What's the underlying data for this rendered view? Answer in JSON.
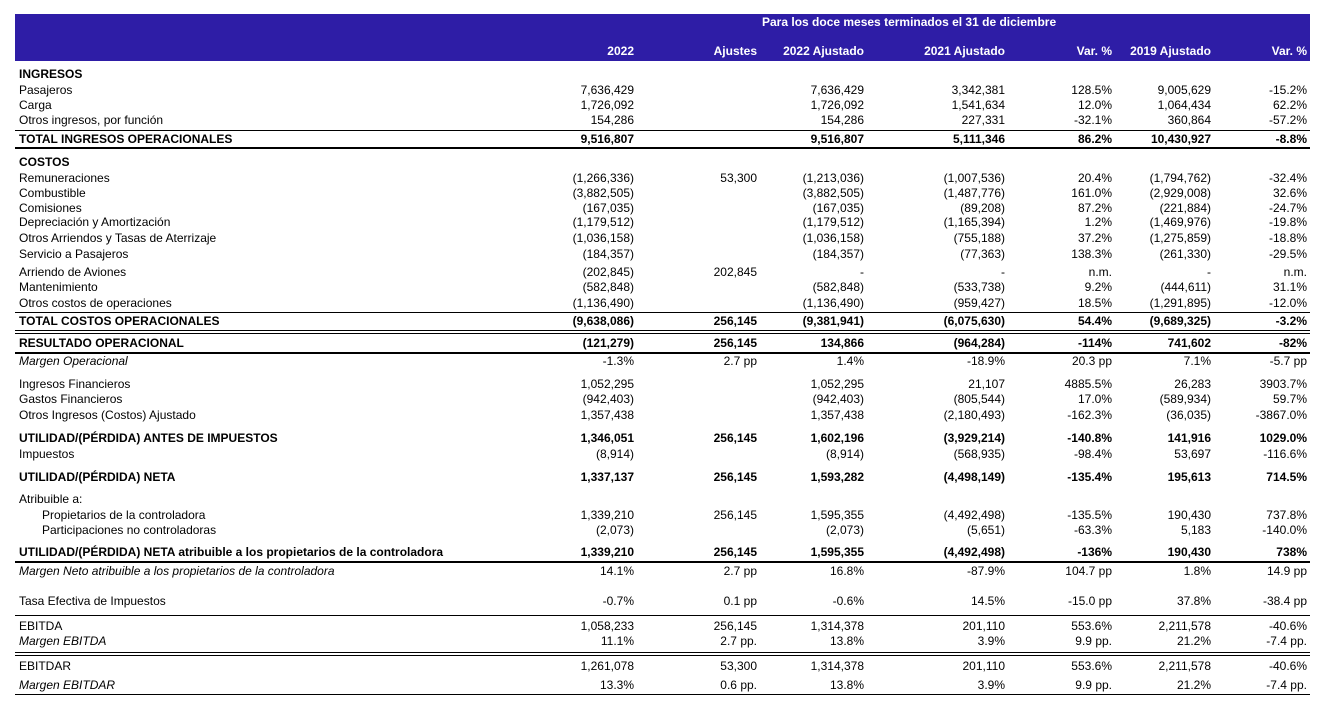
{
  "header": {
    "period": "Para los doce meses terminados el 31 de diciembre",
    "columns": [
      "2022",
      "Ajustes",
      "2022 Ajustado",
      "2021 Ajustado",
      "Var. %",
      "2019 Ajustado",
      "Var. %"
    ]
  },
  "rows": [
    {
      "label": "INGRESOS",
      "values": [
        "",
        "",
        "",
        "",
        "",
        "",
        ""
      ]
    },
    {
      "label": "Pasajeros",
      "values": [
        "7,636,429",
        "",
        "7,636,429",
        "3,342,381",
        "128.5%",
        "9,005,629",
        "-15.2%"
      ]
    },
    {
      "label": "Carga",
      "values": [
        "1,726,092",
        "",
        "1,726,092",
        "1,541,634",
        "12.0%",
        "1,064,434",
        "62.2%"
      ]
    },
    {
      "label": "Otros ingresos, por función",
      "values": [
        "154,286",
        "",
        "154,286",
        "227,331",
        "-32.1%",
        "360,864",
        "-57.2%"
      ]
    },
    {
      "label": "TOTAL INGRESOS OPERACIONALES",
      "values": [
        "9,516,807",
        "",
        "9,516,807",
        "5,111,346",
        "86.2%",
        "10,430,927",
        "-8.8%"
      ]
    },
    {
      "label": "COSTOS",
      "values": [
        "",
        "",
        "",
        "",
        "",
        "",
        ""
      ]
    },
    {
      "label": "Remuneraciones",
      "values": [
        "(1,266,336)",
        "53,300",
        "(1,213,036)",
        "(1,007,536)",
        "20.4%",
        "(1,794,762)",
        "-32.4%"
      ]
    },
    {
      "label": "Combustible",
      "values": [
        "(3,882,505)",
        "",
        "(3,882,505)",
        "(1,487,776)",
        "161.0%",
        "(2,929,008)",
        "32.6%"
      ]
    },
    {
      "label": "Comisiones",
      "values": [
        "(167,035)",
        "",
        "(167,035)",
        "(89,208)",
        "87.2%",
        "(221,884)",
        "-24.7%"
      ]
    },
    {
      "label": "Depreciación y Amortización",
      "values": [
        "(1,179,512)",
        "",
        "(1,179,512)",
        "(1,165,394)",
        "1.2%",
        "(1,469,976)",
        "-19.8%"
      ]
    },
    {
      "label": "Otros Arriendos  y Tasas de Aterrizaje",
      "values": [
        "(1,036,158)",
        "",
        "(1,036,158)",
        "(755,188)",
        "37.2%",
        "(1,275,859)",
        "-18.8%"
      ]
    },
    {
      "label": "Servicio a Pasajeros",
      "values": [
        "(184,357)",
        "",
        "(184,357)",
        "(77,363)",
        "138.3%",
        "(261,330)",
        "-29.5%"
      ]
    },
    {
      "label": "Arriendo de Aviones",
      "values": [
        "(202,845)",
        "202,845",
        "-",
        "-",
        "n.m.",
        "-",
        "n.m."
      ]
    },
    {
      "label": "Mantenimiento",
      "values": [
        "(582,848)",
        "",
        "(582,848)",
        "(533,738)",
        "9.2%",
        "(444,611)",
        "31.1%"
      ]
    },
    {
      "label": "Otros costos de operaciones",
      "values": [
        "(1,136,490)",
        "",
        "(1,136,490)",
        "(959,427)",
        "18.5%",
        "(1,291,895)",
        "-12.0%"
      ]
    },
    {
      "label": "TOTAL COSTOS OPERACIONALES",
      "values": [
        "(9,638,086)",
        "256,145",
        "(9,381,941)",
        "(6,075,630)",
        "54.4%",
        "(9,689,325)",
        "-3.2%"
      ]
    },
    {
      "label": "RESULTADO OPERACIONAL",
      "values": [
        "(121,279)",
        "256,145",
        "134,866",
        "(964,284)",
        "-114%",
        "741,602",
        "-82%"
      ]
    },
    {
      "label": "Margen Operacional",
      "values": [
        "-1.3%",
        "2.7 pp",
        "1.4%",
        "-18.9%",
        "20.3 pp",
        "7.1%",
        "-5.7 pp"
      ]
    },
    {
      "label": "Ingresos Financieros",
      "values": [
        "1,052,295",
        "",
        "1,052,295",
        "21,107",
        "4885.5%",
        "26,283",
        "3903.7%"
      ]
    },
    {
      "label": "Gastos Financieros",
      "values": [
        "(942,403)",
        "",
        "(942,403)",
        "(805,544)",
        "17.0%",
        "(589,934)",
        "59.7%"
      ]
    },
    {
      "label": "Otros Ingresos (Costos) Ajustado",
      "values": [
        "1,357,438",
        "",
        "1,357,438",
        "(2,180,493)",
        "-162.3%",
        "(36,035)",
        "-3867.0%"
      ]
    },
    {
      "label": "UTILIDAD/(PÉRDIDA) ANTES DE IMPUESTOS",
      "values": [
        "1,346,051",
        "256,145",
        "1,602,196",
        "(3,929,214)",
        "-140.8%",
        "141,916",
        "1029.0%"
      ]
    },
    {
      "label": "Impuestos",
      "values": [
        "(8,914)",
        "",
        "(8,914)",
        "(568,935)",
        "-98.4%",
        "53,697",
        "-116.6%"
      ]
    },
    {
      "label": "UTILIDAD/(PÉRDIDA) NETA",
      "values": [
        "1,337,137",
        "256,145",
        "1,593,282",
        "(4,498,149)",
        "-135.4%",
        "195,613",
        "714.5%"
      ]
    },
    {
      "label": "Atribuible a:",
      "values": [
        "",
        "",
        "",
        "",
        "",
        "",
        ""
      ]
    },
    {
      "label": "Propietarios de la controladora",
      "values": [
        "1,339,210",
        "256,145",
        "1,595,355",
        "(4,492,498)",
        "-135.5%",
        "190,430",
        "737.8%"
      ]
    },
    {
      "label": "Participaciones no controladoras",
      "values": [
        "(2,073)",
        "",
        "(2,073)",
        "(5,651)",
        "-63.3%",
        "5,183",
        "-140.0%"
      ]
    },
    {
      "label": "UTILIDAD/(PÉRDIDA) NETA atribuible a los propietarios de la controladora",
      "values": [
        "1,339,210",
        "256,145",
        "1,595,355",
        "(4,492,498)",
        "-136%",
        "190,430",
        "738%"
      ]
    },
    {
      "label": "Margen Neto atribuible a los propietarios de la controladora",
      "values": [
        "14.1%",
        "2.7 pp",
        "16.8%",
        "-87.9%",
        "104.7 pp",
        "1.8%",
        "14.9 pp"
      ]
    },
    {
      "label": "Tasa Efectiva de Impuestos",
      "values": [
        "-0.7%",
        "0.1 pp",
        "-0.6%",
        "14.5%",
        "-15.0 pp",
        "37.8%",
        "-38.4 pp"
      ]
    },
    {
      "label": "EBITDA",
      "values": [
        "1,058,233",
        "256,145",
        "1,314,378",
        "201,110",
        "553.6%",
        "2,211,578",
        "-40.6%"
      ]
    },
    {
      "label": "Margen EBITDA",
      "values": [
        "11.1%",
        "2.7 pp.",
        "13.8%",
        "3.9%",
        "9.9 pp.",
        "21.2%",
        "-7.4 pp."
      ]
    },
    {
      "label": "EBITDAR",
      "values": [
        "1,261,078",
        "53,300",
        "1,314,378",
        "201,110",
        "553.6%",
        "2,211,578",
        "-40.6%"
      ]
    },
    {
      "label": "Margen EBITDAR",
      "values": [
        "13.3%",
        "0.6 pp.",
        "13.8%",
        "3.9%",
        "9.9 pp.",
        "21.2%",
        "-7.4 pp."
      ]
    }
  ]
}
